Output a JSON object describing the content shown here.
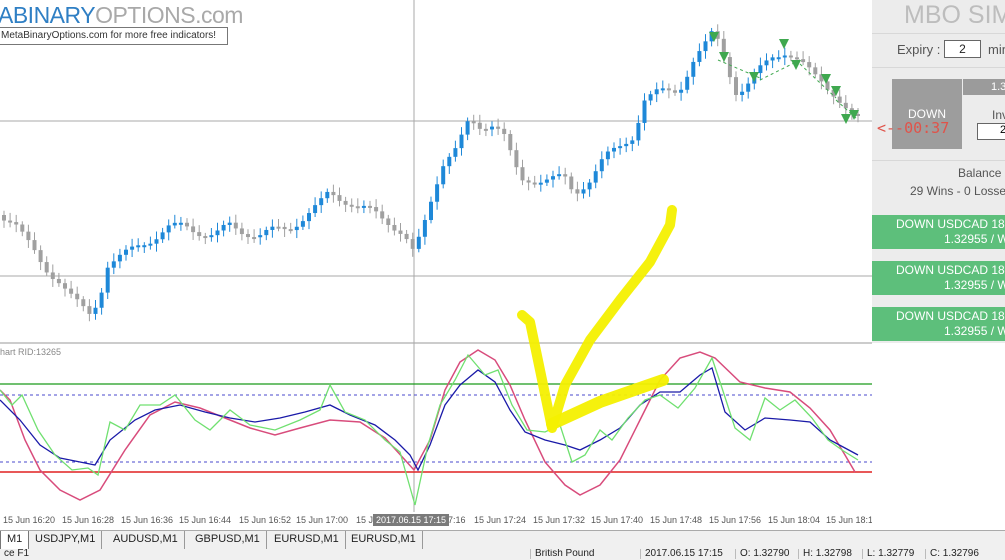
{
  "logo": {
    "part_blue": "ABINARY",
    "part_gray": "OPTIONS.com",
    "note": "MetaBinaryOptions.com for more free indicators!"
  },
  "subwindow_label": "hart RID:13265",
  "crosshair_time": "2017.06.15 17:15",
  "time_axis": [
    "15 Jun 16:20",
    "15 Jun 16:28",
    "15 Jun 16:36",
    "15 Jun 16:44",
    "15 Jun 16:52",
    "15 Jun 17:00",
    "15 Jun 17:0",
    "7:16",
    "15 Jun 17:24",
    "15 Jun 17:32",
    "15 Jun 17:40",
    "15 Jun 17:48",
    "15 Jun 17:56",
    "15 Jun 18:04",
    "15 Jun 18:12"
  ],
  "panel": {
    "title": "MBO SIM",
    "expiry_label": "Expiry :",
    "expiry_value": "2",
    "expiry_unit": "min",
    "price": "1.3",
    "down_label": "DOWN",
    "invest_label": "Inv",
    "invest_value": "2",
    "timer": "<--00:37",
    "balance_label": "Balance",
    "wins": "29 Wins - 0 Losse",
    "trades": [
      {
        "line1": "DOWN USDCAD 18",
        "line2": "1.32955 / W"
      },
      {
        "line1": "DOWN USDCAD 18",
        "line2": "1.32955 / W"
      },
      {
        "line1": "DOWN USDCAD 18",
        "line2": "1.32955 / W"
      }
    ]
  },
  "tabs": [
    "M1",
    "USDJPY,M1",
    "AUDUSD,M1",
    "GBPUSD,M1",
    "EURUSD,M1",
    "EURUSD,M1"
  ],
  "status": [
    "ce F1",
    "British Pound",
    "2017.06.15 17:15",
    "O: 1.32790",
    "H: 1.32798",
    "L: 1.32779",
    "C: 1.32796"
  ],
  "colors": {
    "bull": "#1e88d8",
    "bear": "#a0a0a0",
    "green_line": "#1a9a1a",
    "red_line": "#e02020",
    "signal_line": "#70e070",
    "main_line": "#1a1aa8",
    "pink_line": "#d84c7c",
    "highlight": "#f4f000"
  }
}
